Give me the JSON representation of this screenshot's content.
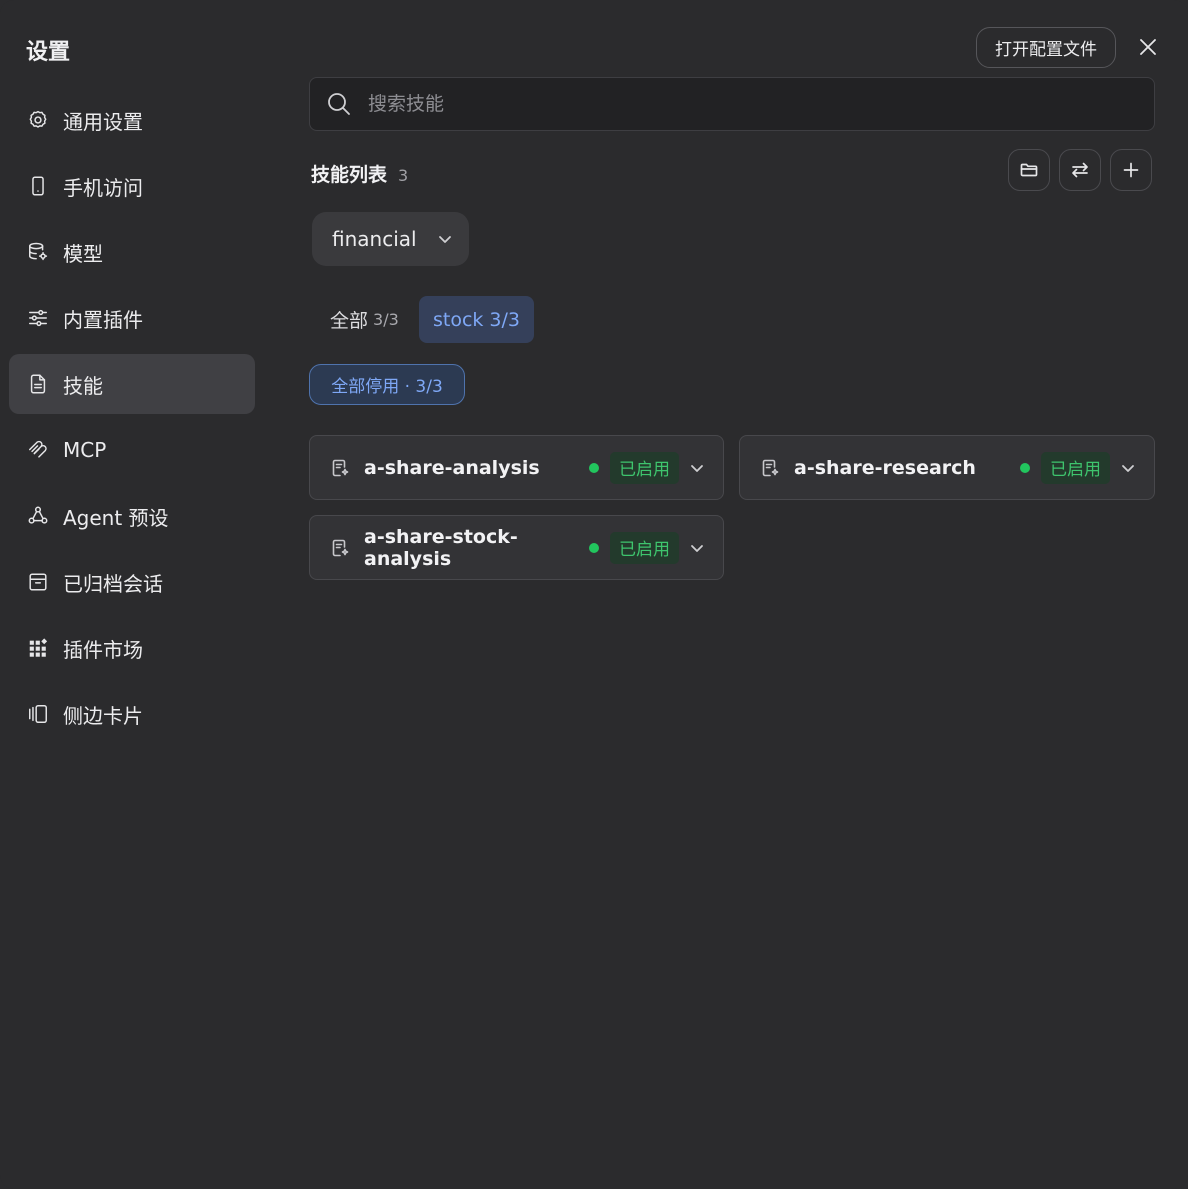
{
  "app_title": "设置",
  "header": {
    "open_config_label": "打开配置文件"
  },
  "sidebar": {
    "items": [
      {
        "label": "通用设置",
        "icon": "gear-icon"
      },
      {
        "label": "手机访问",
        "icon": "phone-icon"
      },
      {
        "label": "模型",
        "icon": "database-settings-icon"
      },
      {
        "label": "内置插件",
        "icon": "sliders-icon"
      },
      {
        "label": "技能",
        "icon": "document-icon",
        "active": true
      },
      {
        "label": "MCP",
        "icon": "mcp-icon"
      },
      {
        "label": "Agent 预设",
        "icon": "agent-nodes-icon"
      },
      {
        "label": "已归档会话",
        "icon": "archive-icon"
      },
      {
        "label": "插件市场",
        "icon": "grid-apps-icon"
      },
      {
        "label": "侧边卡片",
        "icon": "side-cards-icon"
      }
    ]
  },
  "search": {
    "placeholder": "搜索技能",
    "value": ""
  },
  "skills": {
    "title": "技能列表",
    "count": "3",
    "dropdown_value": "financial",
    "tabs": [
      {
        "label": "全部",
        "count": "3/3"
      },
      {
        "label": "stock 3/3",
        "active": true
      }
    ],
    "disable_all_label": "全部停用 · 3/3",
    "items": [
      {
        "name": "a-share-analysis",
        "status": "已启用"
      },
      {
        "name": "a-share-research",
        "status": "已启用"
      },
      {
        "name": "a-share-stock-analysis",
        "status": "已启用"
      }
    ]
  },
  "colors": {
    "background": "#2b2b2d",
    "accent_blue": "#7fa8f6",
    "enabled_green": "#22c55e"
  }
}
